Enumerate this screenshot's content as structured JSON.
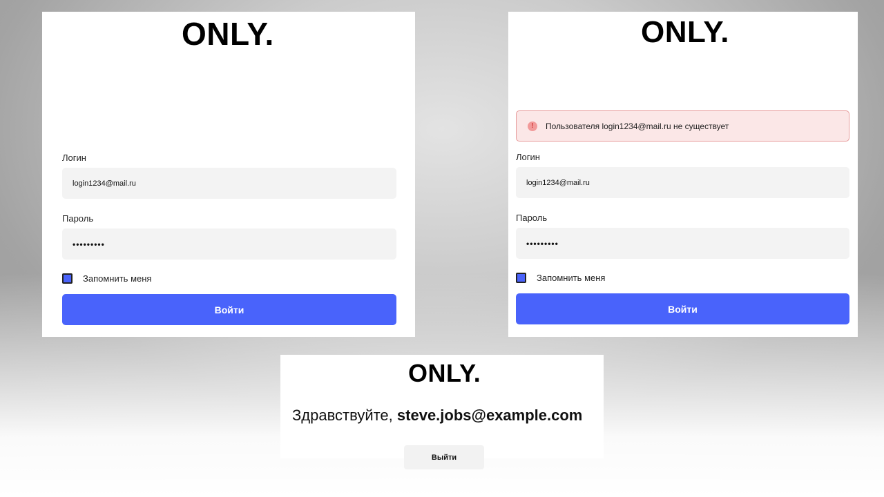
{
  "brand": {
    "logo_text": "ONLY."
  },
  "login_screen": {
    "login_label": "Логин",
    "login_value": "login1234@mail.ru",
    "password_label": "Пароль",
    "password_value": "•••••••••",
    "remember_label": "Запомнить меня",
    "remember_checked": true,
    "submit_label": "Войти"
  },
  "error_screen": {
    "error_message": "Пользователя login1234@mail.ru не существует",
    "login_label": "Логин",
    "login_value": "login1234@mail.ru",
    "password_label": "Пароль",
    "password_value": "•••••••••",
    "remember_label": "Запомнить меня",
    "remember_checked": true,
    "submit_label": "Войти"
  },
  "welcome_screen": {
    "greeting_prefix": "Здравствуйте, ",
    "user_email": "steve.jobs@example.com",
    "logout_label": "Выйти"
  },
  "icons": {
    "error": "exclamation-circle-icon",
    "checkbox": "checkbox-checked-icon"
  },
  "colors": {
    "accent": "#4963fb",
    "field_bg": "#f3f3f3",
    "error_bg": "#fbe7e7",
    "error_border": "#e79a9a",
    "error_icon": "#d33d3d"
  }
}
